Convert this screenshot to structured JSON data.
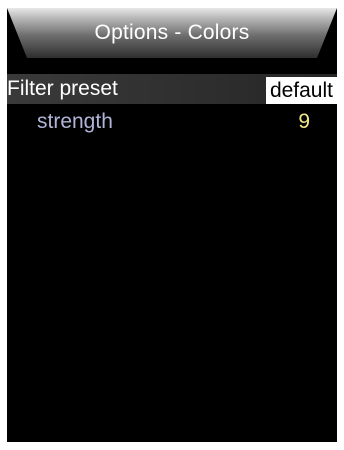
{
  "header": {
    "title": "Options - Colors"
  },
  "menu": {
    "items": [
      {
        "label": "Filter preset",
        "value": "default",
        "selected": true
      },
      {
        "label": "strength",
        "value": "9",
        "selected": false
      }
    ]
  },
  "colors": {
    "background": "#000000",
    "header_gradient_light": "#d8d8d8",
    "header_gradient_dark": "#3a3a3a",
    "selected_row": "#3a3a3a",
    "sub_label": "#b0b4d6",
    "sub_value": "#f2e88a"
  }
}
